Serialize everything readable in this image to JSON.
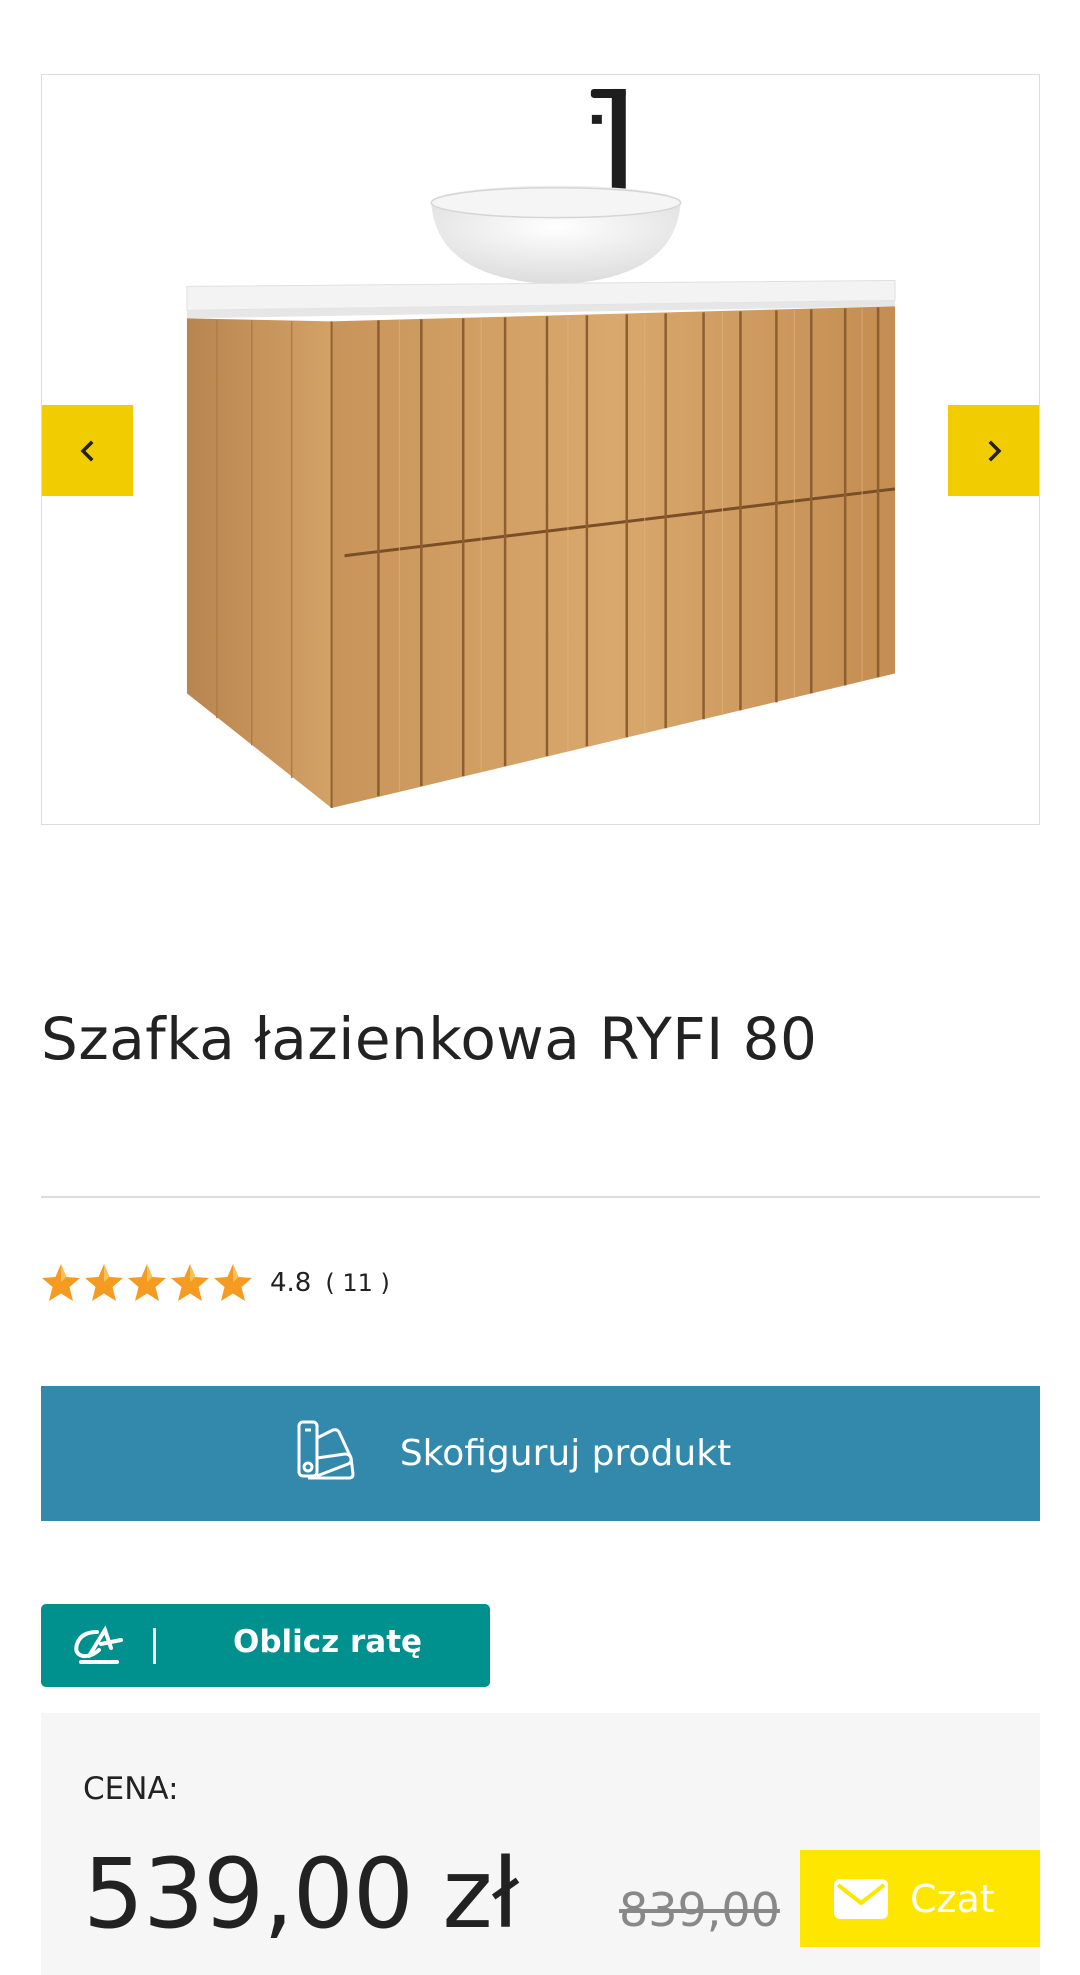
{
  "gallery": {
    "product_image_alt": "Szafka łazienkowa RYFI 80",
    "prev_icon": "chevron-left-icon",
    "next_icon": "chevron-right-icon",
    "nav_color": "#f1cc00"
  },
  "product": {
    "title": "Szafka łazienkowa RYFI 80",
    "rating_value": "4.8",
    "rating_count": "( 11 )",
    "stars": 4.8
  },
  "configure": {
    "label": "Skofiguruj produkt",
    "icon": "palette-swatch-icon",
    "color": "#3289ab"
  },
  "installment": {
    "label": "Oblicz ratę",
    "logo": "credit-agricole-logo",
    "color": "#00918f"
  },
  "price": {
    "label": "CENA:",
    "current": "539,00 zł",
    "old": "839,00"
  },
  "chat": {
    "label": "Czat",
    "icon": "envelope-icon",
    "color": "#ffe600"
  }
}
